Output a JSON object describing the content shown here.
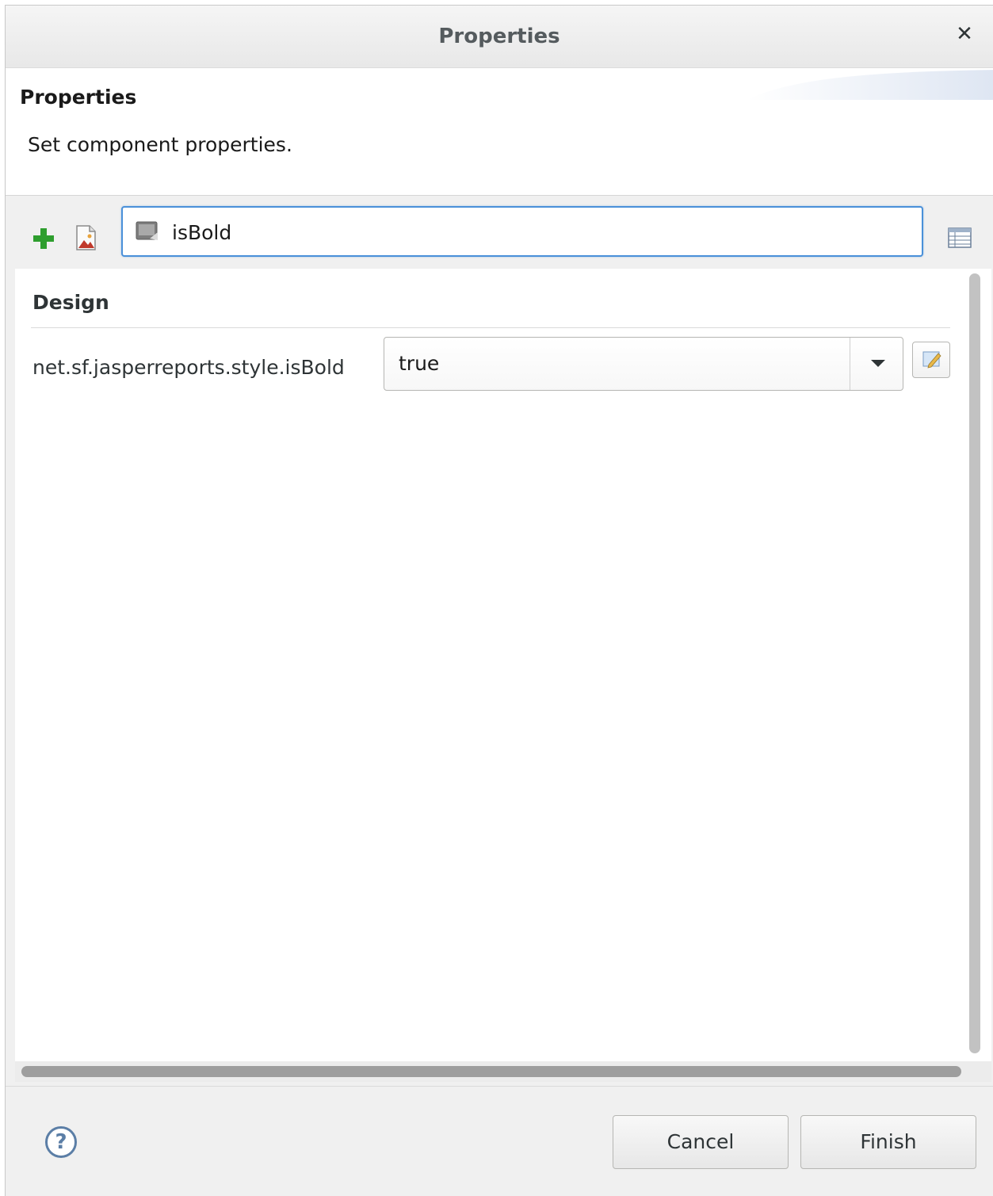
{
  "window": {
    "title": "Properties"
  },
  "header": {
    "title": "Properties",
    "description": "Set component properties."
  },
  "toolbar": {
    "add_icon": "plus-icon",
    "image_icon": "image-icon",
    "search_value": "isBold",
    "search_icon": "property-icon",
    "view_icon": "table-view-icon"
  },
  "content": {
    "section_title": "Design",
    "property": {
      "label": "net.sf.jasperreports.style.isBold",
      "value": "true",
      "edit_icon": "edit-expression-icon"
    }
  },
  "footer": {
    "help_label": "?",
    "cancel_label": "Cancel",
    "finish_label": "Finish"
  },
  "colors": {
    "focus_border": "#4a90d9",
    "add_green": "#2e9e2e"
  }
}
